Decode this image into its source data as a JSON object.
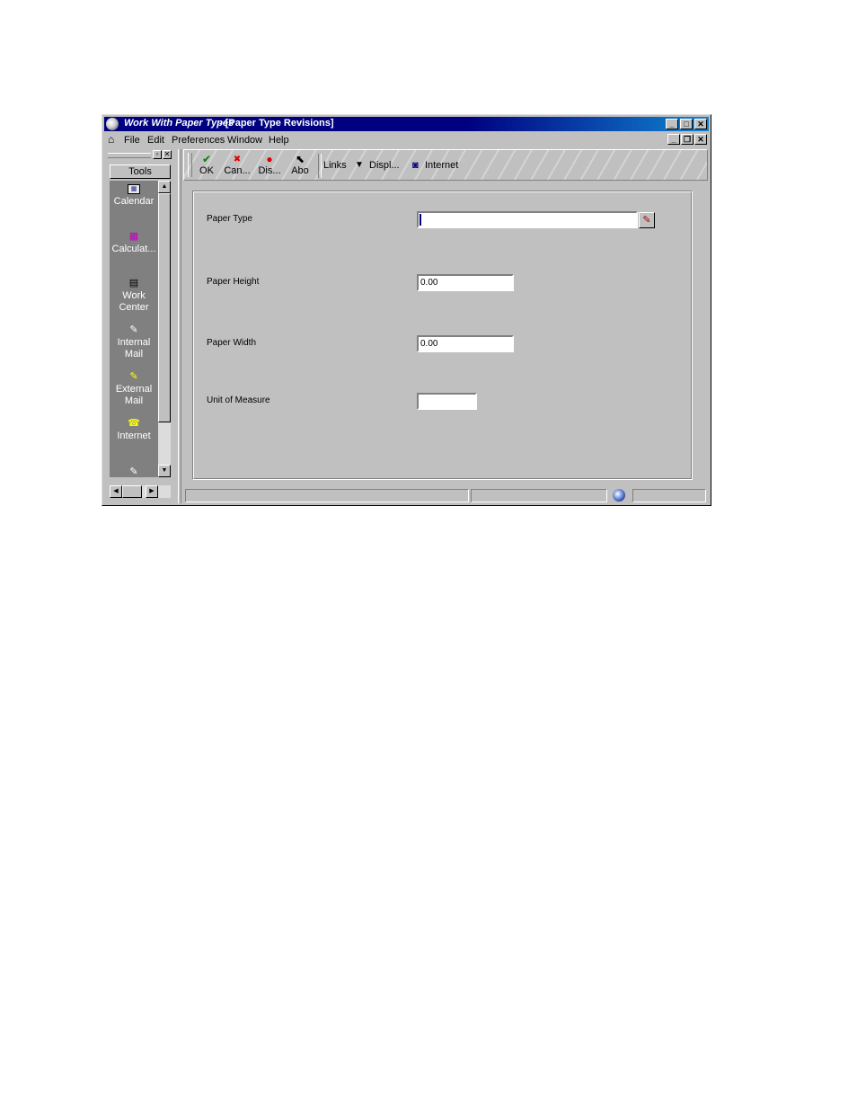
{
  "window": {
    "title_app": "Work With Paper Types",
    "title_form": "- [Paper Type Revisions]",
    "buttons": {
      "minimize": "_",
      "maximize": "□",
      "close": "✕"
    }
  },
  "menubar": {
    "items": [
      {
        "label": "File"
      },
      {
        "label": "Edit"
      },
      {
        "label": "Preferences"
      },
      {
        "label": "Window"
      },
      {
        "label": "Help"
      }
    ],
    "mdi_buttons": {
      "minimize": "_",
      "restore": "❐",
      "close": "✕"
    }
  },
  "toolpane": {
    "header_buttons": {
      "float": "▫",
      "close": "✕"
    },
    "tools_label": "Tools",
    "items": [
      {
        "label": "Calendar",
        "icon": "calendar-icon"
      },
      {
        "label": "Calculat...",
        "icon": "calculator-icon"
      },
      {
        "label": "Work Center",
        "icon": "work-center-icon"
      },
      {
        "label": "Internal Mail",
        "icon": "internal-mail-icon"
      },
      {
        "label": "External Mail",
        "icon": "external-mail-icon"
      },
      {
        "label": "Internet",
        "icon": "internet-phone-icon"
      }
    ]
  },
  "toolbar": {
    "ok_label": "OK",
    "cancel_label": "Can...",
    "display_label": "Dis...",
    "about_label": "Abo",
    "links_label": "Links",
    "display_menu_label": "Displ...",
    "internet_label": "Internet"
  },
  "form": {
    "paper_type_label": "Paper Type",
    "paper_type_value": "",
    "paper_height_label": "Paper Height",
    "paper_height_value": "0.00",
    "paper_width_label": "Paper Width",
    "paper_width_value": "0.00",
    "uom_label": "Unit of Measure",
    "uom_value": ""
  },
  "colors": {
    "title_bar": "#000080",
    "window_face": "#c0c0c0",
    "tool_list_bg": "#808080"
  }
}
